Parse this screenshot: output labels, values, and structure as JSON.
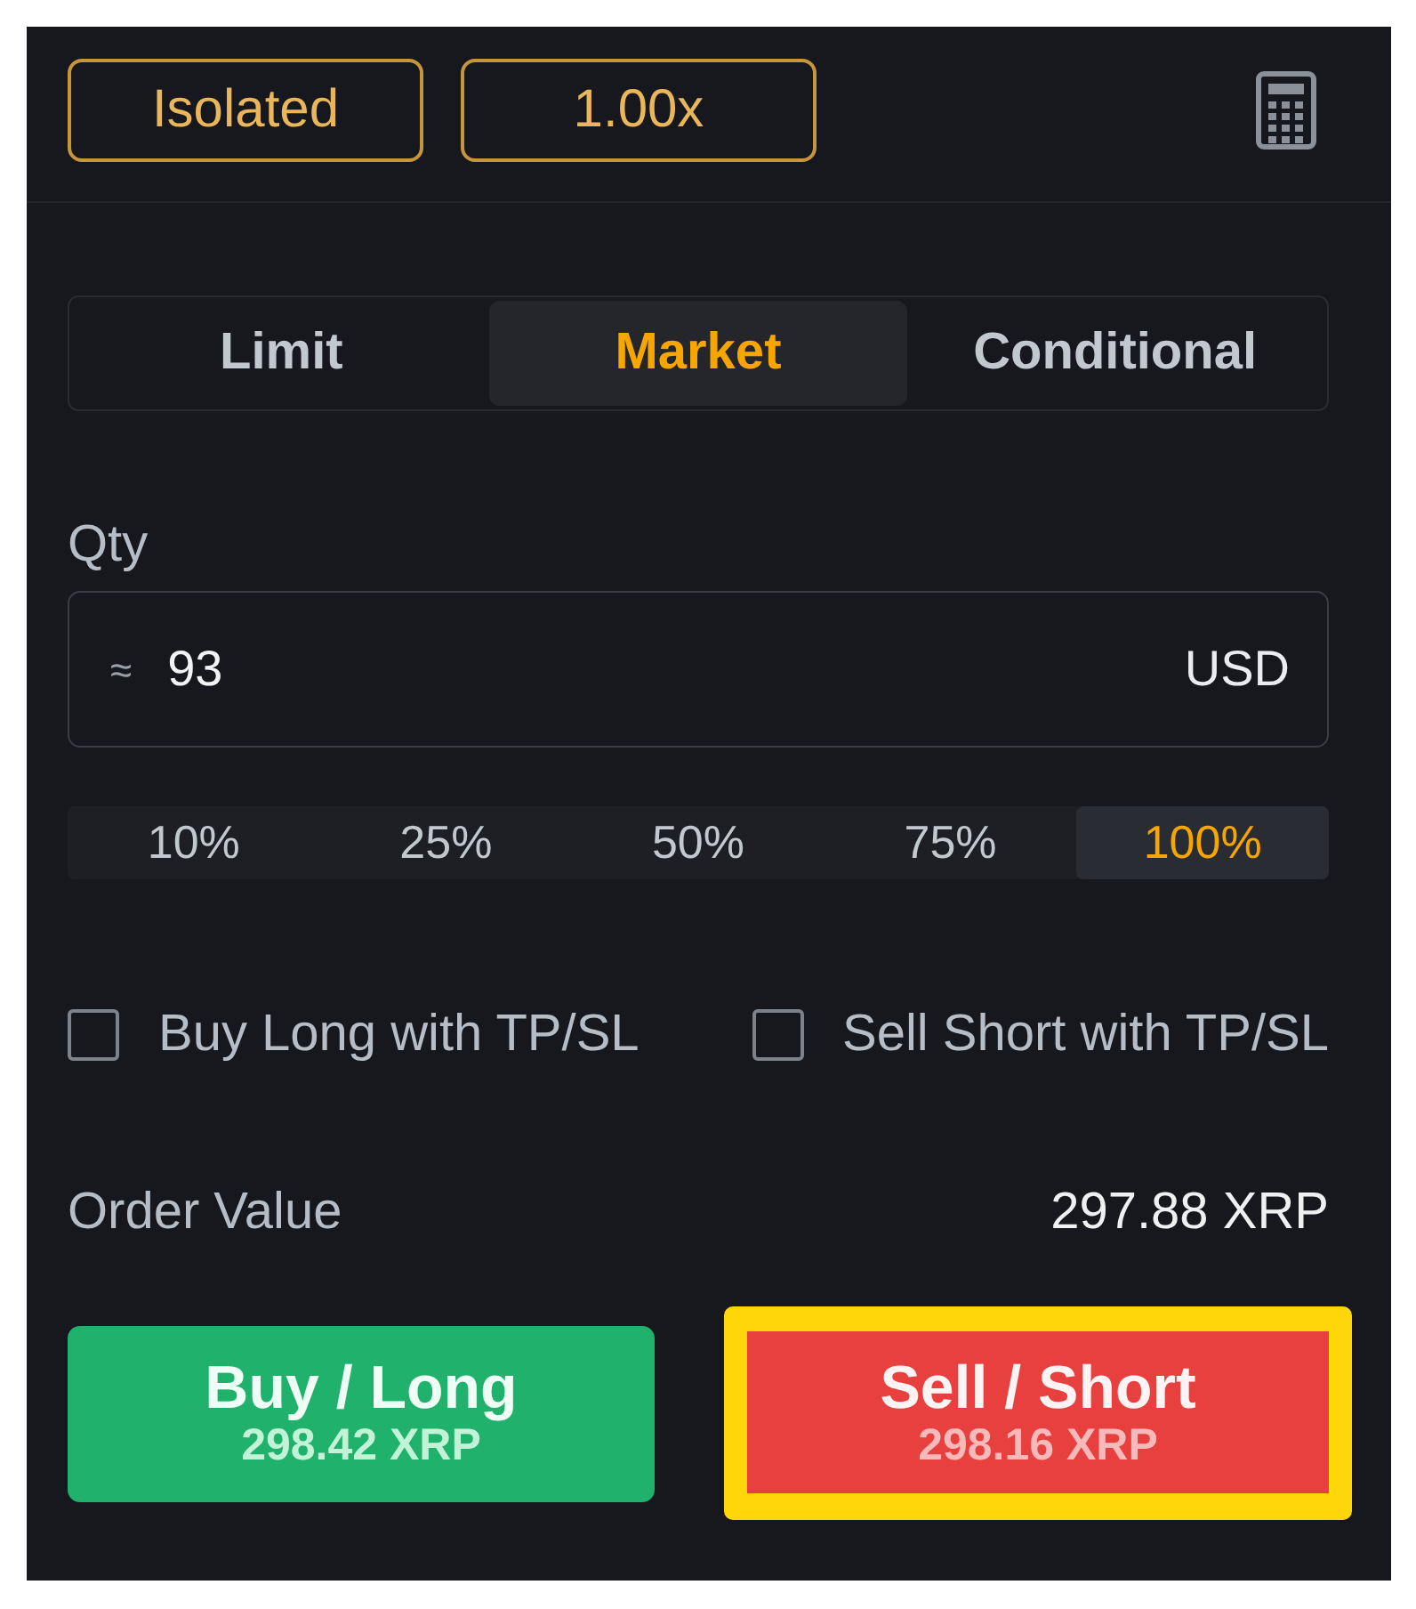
{
  "top_buttons": [
    {
      "label": "Isolated"
    },
    {
      "label": "1.00x"
    }
  ],
  "order_types": [
    {
      "label": "Limit",
      "selected": false
    },
    {
      "label": "Market",
      "selected": true
    },
    {
      "label": "Conditional",
      "selected": false
    }
  ],
  "qty": {
    "label": "Qty",
    "prefix": "≈",
    "value": "93",
    "unit": "USD"
  },
  "percentages": [
    {
      "label": "10%",
      "selected": false
    },
    {
      "label": "25%",
      "selected": false
    },
    {
      "label": "50%",
      "selected": false
    },
    {
      "label": "75%",
      "selected": false
    },
    {
      "label": "100%",
      "selected": true
    }
  ],
  "tpsl_options": [
    {
      "label": "Buy Long with TP/SL",
      "checked": false
    },
    {
      "label": "Sell Short with TP/SL",
      "checked": false
    }
  ],
  "order_value": {
    "label": "Order Value",
    "value": "297.88 XRP"
  },
  "actions": [
    {
      "kind": "buy",
      "label": "Buy / Long",
      "price": "298.42 XRP",
      "highlighted": false
    },
    {
      "kind": "sell",
      "label": "Sell / Short",
      "price": "298.16 XRP",
      "highlighted": true
    }
  ]
}
